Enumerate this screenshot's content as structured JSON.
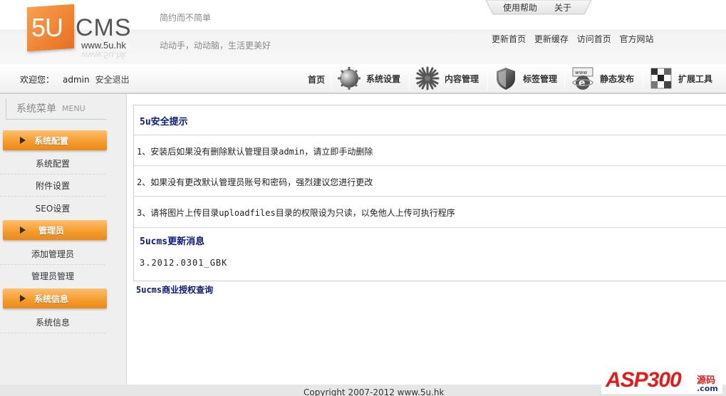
{
  "header": {
    "logo": {
      "mark": "5U",
      "brand": "CMS",
      "url": "www.5u.hk"
    },
    "slogan_top": "简约而不简单",
    "slogan_bottom": "动动手，动动脑，生活更美好",
    "help_links": [
      "使用帮助",
      "关于"
    ],
    "quick_links": [
      "更新首页",
      "更新缓存",
      "访问首页",
      "官方网站"
    ]
  },
  "navbar": {
    "welcome_label": "欢迎您：",
    "username": "admin",
    "logout": "安全退出",
    "home": "首页",
    "items": [
      {
        "label": "系统设置",
        "icon": "gear-sphere-icon"
      },
      {
        "label": "内容管理",
        "icon": "starburst-icon"
      },
      {
        "label": "标签管理",
        "icon": "shield-icon"
      },
      {
        "label": "静态发布",
        "icon": "ie-web-icon"
      },
      {
        "label": "扩展工具",
        "icon": "checker-grid-icon"
      }
    ]
  },
  "sidebar": {
    "title": "系统菜单",
    "title_en": "MENU",
    "groups": [
      {
        "label": "系统配置",
        "items": [
          "系统配置",
          "附件设置",
          "SEO设置"
        ]
      },
      {
        "label": "管理员",
        "items": [
          "添加管理员",
          "管理员管理"
        ]
      },
      {
        "label": "系统信息",
        "items": [
          "系统信息"
        ]
      }
    ]
  },
  "content": {
    "security_title": "5u安全提示",
    "tips": [
      "1、安装后如果没有删除默认管理目录admin，请立即手动删除",
      "2、如果没有更改默认管理员账号和密码，强烈建议您进行更改",
      "3、请将图片上传目录uploadfiles目录的权限设为只读，以免他人上传可执行程序"
    ],
    "update_title": "5ucms更新消息",
    "version": "3.2012.0301_GBK",
    "license_link": "5ucms商业授权查询"
  },
  "footer": {
    "copyright": "Copyright 2007-2012 www.5u.hk"
  },
  "watermark": {
    "brand": "ASP300",
    "tag": "源码",
    "domain": ".com"
  }
}
